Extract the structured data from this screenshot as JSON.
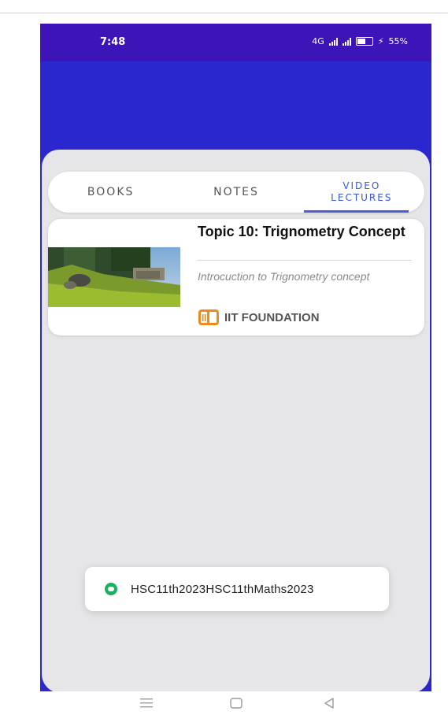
{
  "status_bar": {
    "time": "7:48",
    "network": "4G",
    "battery_percent": "55%"
  },
  "tabs": [
    {
      "label": "BOOKS",
      "active": false
    },
    {
      "label": "NOTES",
      "active": false
    },
    {
      "label": "VIDEO\nLECTURES",
      "active": true
    }
  ],
  "lecture_card": {
    "title": "Topic 10: Trignometry Concept",
    "subtitle": "Introcuction to Trignometry concept",
    "tag_label": "IIT FOUNDATION",
    "tag_icon": "course-icon"
  },
  "toast": {
    "text": "HSC11th2023HSC11thMaths2023",
    "icon": "app-icon"
  },
  "nav_bar": {
    "menu_icon": "menu-icon",
    "home_icon": "home-icon",
    "back_icon": "back-icon"
  },
  "colors": {
    "header": "#2a27cf",
    "status_bar": "#3c14b8",
    "active_tab": "#3b56d6",
    "sheet": "#e6e6e8",
    "toast_icon": "#18b15e",
    "tag_icon": "#ef8a1c"
  }
}
